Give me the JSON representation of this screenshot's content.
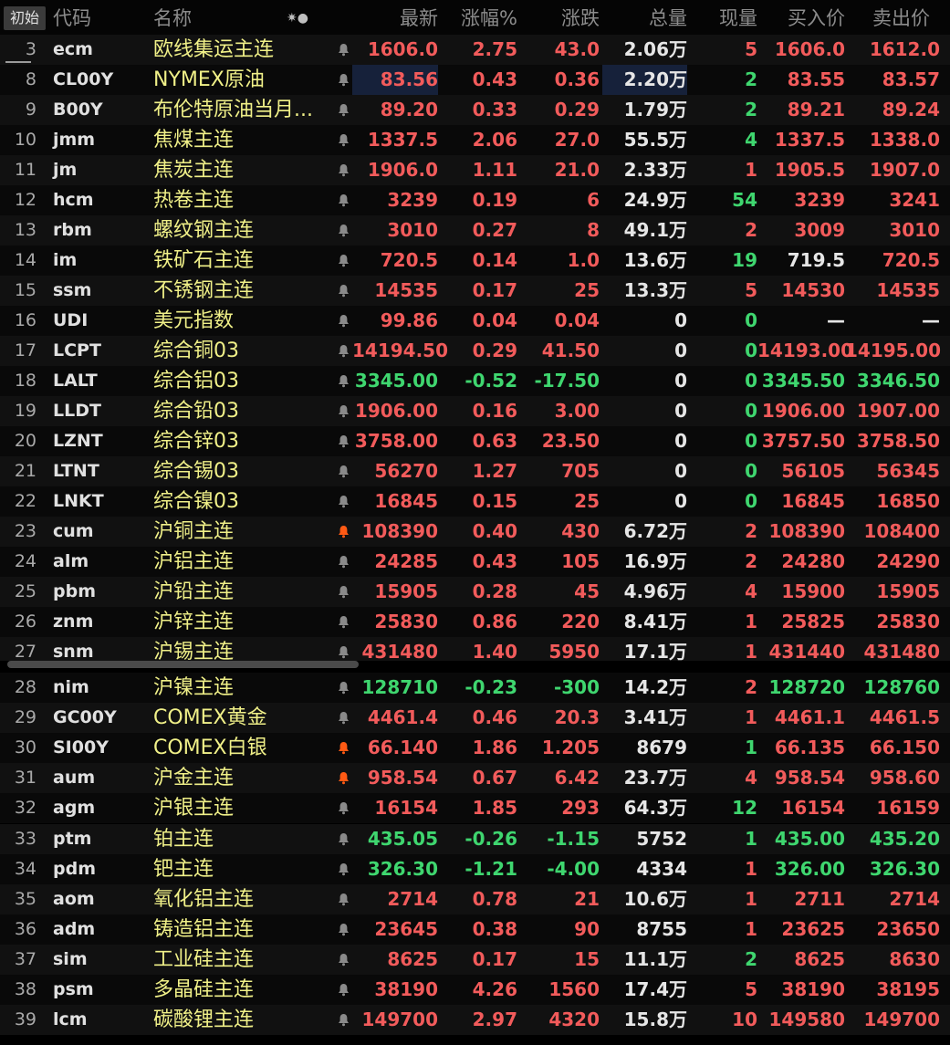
{
  "header": {
    "reset_label": "初始",
    "columns": {
      "code": "代码",
      "name": "名称",
      "last": "最新",
      "pct": "涨幅%",
      "chg": "涨跌",
      "vol": "总量",
      "cur": "现量",
      "bid": "买入价",
      "ask": "卖出价"
    },
    "sort_indicator": "✷●"
  },
  "colors": {
    "up": "#f25b5b",
    "down": "#3fd66f",
    "name": "#f0f088",
    "alert_on": "#ff5a14"
  },
  "icons": {
    "alert": "bell-icon"
  },
  "rows": [
    {
      "idx": "3",
      "code": "ecm",
      "name": "欧线集运主连",
      "bell": false,
      "last": "1606.0",
      "pct": "2.75",
      "chg": "43.0",
      "vol": "2.06万",
      "cur": "5",
      "bid": "1606.0",
      "ask": "1612.0",
      "d": "up",
      "cd": "up"
    },
    {
      "idx": "8",
      "code": "CL00Y",
      "name": "NYMEX原油",
      "bell": false,
      "last": "83.56",
      "pct": "0.43",
      "chg": "0.36",
      "vol": "2.20万",
      "cur": "2",
      "bid": "83.55",
      "ask": "83.57",
      "d": "up",
      "cd": "dn"
    },
    {
      "idx": "9",
      "code": "B00Y",
      "name": "布伦特原油当月...",
      "bell": false,
      "last": "89.20",
      "pct": "0.33",
      "chg": "0.29",
      "vol": "1.79万",
      "cur": "2",
      "bid": "89.21",
      "ask": "89.24",
      "d": "up",
      "cd": "dn"
    },
    {
      "idx": "10",
      "code": "jmm",
      "name": "焦煤主连",
      "bell": false,
      "last": "1337.5",
      "pct": "2.06",
      "chg": "27.0",
      "vol": "55.5万",
      "cur": "4",
      "bid": "1337.5",
      "ask": "1338.0",
      "d": "up",
      "cd": "dn"
    },
    {
      "idx": "11",
      "code": "jm",
      "name": "焦炭主连",
      "bell": false,
      "last": "1906.0",
      "pct": "1.11",
      "chg": "21.0",
      "vol": "2.33万",
      "cur": "1",
      "bid": "1905.5",
      "ask": "1907.0",
      "d": "up",
      "cd": "up"
    },
    {
      "idx": "12",
      "code": "hcm",
      "name": "热卷主连",
      "bell": false,
      "last": "3239",
      "pct": "0.19",
      "chg": "6",
      "vol": "24.9万",
      "cur": "54",
      "bid": "3239",
      "ask": "3241",
      "d": "up",
      "cd": "dn"
    },
    {
      "idx": "13",
      "code": "rbm",
      "name": "螺纹钢主连",
      "bell": false,
      "last": "3010",
      "pct": "0.27",
      "chg": "8",
      "vol": "49.1万",
      "cur": "2",
      "bid": "3009",
      "ask": "3010",
      "d": "up",
      "cd": "up"
    },
    {
      "idx": "14",
      "code": "im",
      "name": "铁矿石主连",
      "bell": false,
      "last": "720.5",
      "pct": "0.14",
      "chg": "1.0",
      "vol": "13.6万",
      "cur": "19",
      "bid": "719.5",
      "ask": "720.5",
      "d": "up",
      "cd": "dn",
      "bd": "wh"
    },
    {
      "idx": "15",
      "code": "ssm",
      "name": "不锈钢主连",
      "bell": false,
      "last": "14535",
      "pct": "0.17",
      "chg": "25",
      "vol": "13.3万",
      "cur": "5",
      "bid": "14530",
      "ask": "14535",
      "d": "up",
      "cd": "up"
    },
    {
      "idx": "16",
      "code": "UDI",
      "name": "美元指数",
      "bell": false,
      "last": "99.86",
      "pct": "0.04",
      "chg": "0.04",
      "vol": "0",
      "cur": "0",
      "bid": "—",
      "ask": "—",
      "d": "up",
      "cd": "dn",
      "bd": "wh",
      "ad": "wh"
    },
    {
      "idx": "17",
      "code": "LCPT",
      "name": "综合铜03",
      "bell": false,
      "last": "14194.50",
      "pct": "0.29",
      "chg": "41.50",
      "vol": "0",
      "cur": "0",
      "bid": "14193.00",
      "ask": "14195.00",
      "d": "up",
      "cd": "dn"
    },
    {
      "idx": "18",
      "code": "LALT",
      "name": "综合铝03",
      "bell": false,
      "last": "3345.00",
      "pct": "-0.52",
      "chg": "-17.50",
      "vol": "0",
      "cur": "0",
      "bid": "3345.50",
      "ask": "3346.50",
      "d": "dn",
      "cd": "dn"
    },
    {
      "idx": "19",
      "code": "LLDT",
      "name": "综合铅03",
      "bell": false,
      "last": "1906.00",
      "pct": "0.16",
      "chg": "3.00",
      "vol": "0",
      "cur": "0",
      "bid": "1906.00",
      "ask": "1907.00",
      "d": "up",
      "cd": "dn"
    },
    {
      "idx": "20",
      "code": "LZNT",
      "name": "综合锌03",
      "bell": false,
      "last": "3758.00",
      "pct": "0.63",
      "chg": "23.50",
      "vol": "0",
      "cur": "0",
      "bid": "3757.50",
      "ask": "3758.50",
      "d": "up",
      "cd": "dn"
    },
    {
      "idx": "21",
      "code": "LTNT",
      "name": "综合锡03",
      "bell": false,
      "last": "56270",
      "pct": "1.27",
      "chg": "705",
      "vol": "0",
      "cur": "0",
      "bid": "56105",
      "ask": "56345",
      "d": "up",
      "cd": "dn"
    },
    {
      "idx": "22",
      "code": "LNKT",
      "name": "综合镍03",
      "bell": false,
      "last": "16845",
      "pct": "0.15",
      "chg": "25",
      "vol": "0",
      "cur": "0",
      "bid": "16845",
      "ask": "16850",
      "d": "up",
      "cd": "dn"
    },
    {
      "idx": "23",
      "code": "cum",
      "name": "沪铜主连",
      "bell": true,
      "last": "108390",
      "pct": "0.40",
      "chg": "430",
      "vol": "6.72万",
      "cur": "2",
      "bid": "108390",
      "ask": "108400",
      "d": "up",
      "cd": "up"
    },
    {
      "idx": "24",
      "code": "alm",
      "name": "沪铝主连",
      "bell": false,
      "last": "24285",
      "pct": "0.43",
      "chg": "105",
      "vol": "16.9万",
      "cur": "2",
      "bid": "24280",
      "ask": "24290",
      "d": "up",
      "cd": "up"
    },
    {
      "idx": "25",
      "code": "pbm",
      "name": "沪铅主连",
      "bell": false,
      "last": "15905",
      "pct": "0.28",
      "chg": "45",
      "vol": "4.96万",
      "cur": "4",
      "bid": "15900",
      "ask": "15905",
      "d": "up",
      "cd": "up"
    },
    {
      "idx": "26",
      "code": "znm",
      "name": "沪锌主连",
      "bell": false,
      "last": "25830",
      "pct": "0.86",
      "chg": "220",
      "vol": "8.41万",
      "cur": "1",
      "bid": "25825",
      "ask": "25830",
      "d": "up",
      "cd": "up"
    },
    {
      "idx": "27",
      "code": "snm",
      "name": "沪锡主连",
      "bell": false,
      "last": "431480",
      "pct": "1.40",
      "chg": "5950",
      "vol": "17.1万",
      "cur": "1",
      "bid": "431440",
      "ask": "431480",
      "d": "up",
      "cd": "up"
    },
    {
      "idx": "28",
      "code": "nim",
      "name": "沪镍主连",
      "bell": false,
      "last": "128710",
      "pct": "-0.23",
      "chg": "-300",
      "vol": "14.2万",
      "cur": "2",
      "bid": "128720",
      "ask": "128760",
      "d": "dn",
      "cd": "up"
    },
    {
      "idx": "29",
      "code": "GC00Y",
      "name": "COMEX黄金",
      "bell": false,
      "last": "4461.4",
      "pct": "0.46",
      "chg": "20.3",
      "vol": "3.41万",
      "cur": "1",
      "bid": "4461.1",
      "ask": "4461.5",
      "d": "up",
      "cd": "up"
    },
    {
      "idx": "30",
      "code": "SI00Y",
      "name": "COMEX白银",
      "bell": true,
      "last": "66.140",
      "pct": "1.86",
      "chg": "1.205",
      "vol": "8679",
      "cur": "1",
      "bid": "66.135",
      "ask": "66.150",
      "d": "up",
      "cd": "dn"
    },
    {
      "idx": "31",
      "code": "aum",
      "name": "沪金主连",
      "bell": true,
      "last": "958.54",
      "pct": "0.67",
      "chg": "6.42",
      "vol": "23.7万",
      "cur": "4",
      "bid": "958.54",
      "ask": "958.60",
      "d": "up",
      "cd": "up"
    },
    {
      "idx": "32",
      "code": "agm",
      "name": "沪银主连",
      "bell": false,
      "last": "16154",
      "pct": "1.85",
      "chg": "293",
      "vol": "64.3万",
      "cur": "12",
      "bid": "16154",
      "ask": "16159",
      "d": "up",
      "cd": "dn"
    },
    {
      "idx": "33",
      "code": "ptm",
      "name": "铂主连",
      "bell": false,
      "last": "435.05",
      "pct": "-0.26",
      "chg": "-1.15",
      "vol": "5752",
      "cur": "1",
      "bid": "435.00",
      "ask": "435.20",
      "d": "dn",
      "cd": "dn"
    },
    {
      "idx": "34",
      "code": "pdm",
      "name": "钯主连",
      "bell": false,
      "last": "326.30",
      "pct": "-1.21",
      "chg": "-4.00",
      "vol": "4334",
      "cur": "1",
      "bid": "326.00",
      "ask": "326.30",
      "d": "dn",
      "cd": "up"
    },
    {
      "idx": "35",
      "code": "aom",
      "name": "氧化铝主连",
      "bell": false,
      "last": "2714",
      "pct": "0.78",
      "chg": "21",
      "vol": "10.6万",
      "cur": "1",
      "bid": "2711",
      "ask": "2714",
      "d": "up",
      "cd": "up"
    },
    {
      "idx": "36",
      "code": "adm",
      "name": "铸造铝主连",
      "bell": false,
      "last": "23645",
      "pct": "0.38",
      "chg": "90",
      "vol": "8755",
      "cur": "1",
      "bid": "23625",
      "ask": "23650",
      "d": "up",
      "cd": "up"
    },
    {
      "idx": "37",
      "code": "sim",
      "name": "工业硅主连",
      "bell": false,
      "last": "8625",
      "pct": "0.17",
      "chg": "15",
      "vol": "11.1万",
      "cur": "2",
      "bid": "8625",
      "ask": "8630",
      "d": "up",
      "cd": "dn"
    },
    {
      "idx": "38",
      "code": "psm",
      "name": "多晶硅主连",
      "bell": false,
      "last": "38190",
      "pct": "4.26",
      "chg": "1560",
      "vol": "17.4万",
      "cur": "5",
      "bid": "38190",
      "ask": "38195",
      "d": "up",
      "cd": "up"
    },
    {
      "idx": "39",
      "code": "lcm",
      "name": "碳酸锂主连",
      "bell": false,
      "last": "149700",
      "pct": "2.97",
      "chg": "4320",
      "vol": "15.8万",
      "cur": "10",
      "bid": "149580",
      "ask": "149700",
      "d": "up",
      "cd": "up"
    }
  ]
}
